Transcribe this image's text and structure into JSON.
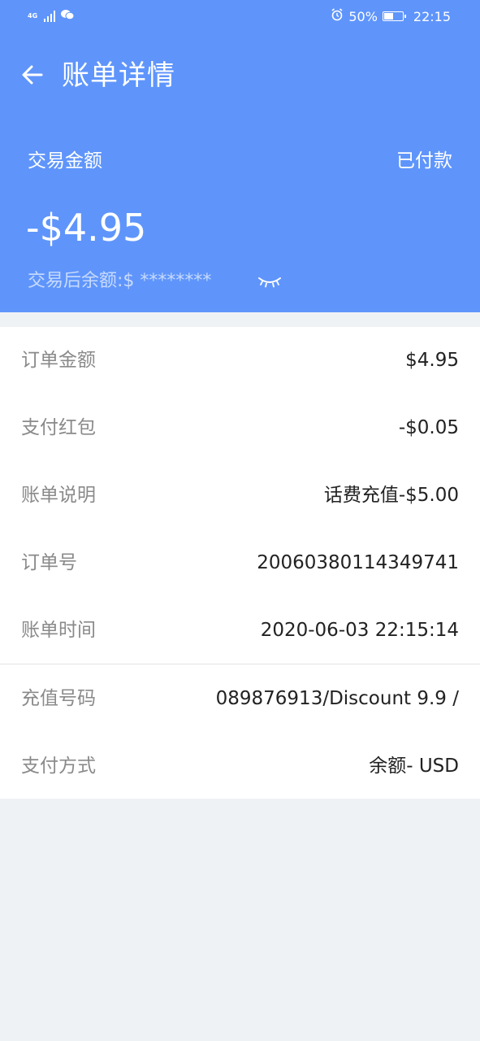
{
  "status_bar": {
    "network": "4G",
    "battery": "50%",
    "time": "22:15",
    "icons": [
      "signal-icon",
      "wechat-icon",
      "alarm-icon",
      "battery-icon"
    ]
  },
  "header": {
    "title": "账单详情",
    "back_icon": "arrow-left-icon"
  },
  "transaction": {
    "label": "交易金额",
    "status": "已付款",
    "amount": "-$4.95",
    "balance_text": "交易后余额:$ ********",
    "eye_icon": "eye-closed-icon"
  },
  "details": [
    {
      "label": "订单金额",
      "value": "$4.95"
    },
    {
      "label": "支付红包",
      "value": "-$0.05"
    },
    {
      "label": "账单说明",
      "value": "话费充值-$5.00"
    },
    {
      "label": "订单号",
      "value": "20060380114349741"
    },
    {
      "label": "账单时间",
      "value": "2020-06-03 22:15:14"
    },
    {
      "label": "充值号码",
      "value": "089876913/Discount 9.9 /"
    },
    {
      "label": "支付方式",
      "value": "余额- USD"
    }
  ],
  "colors": {
    "primary": "#5f95fb",
    "background": "#eff2f5",
    "label_gray": "#8a8a8a",
    "value_dark": "#222222"
  }
}
